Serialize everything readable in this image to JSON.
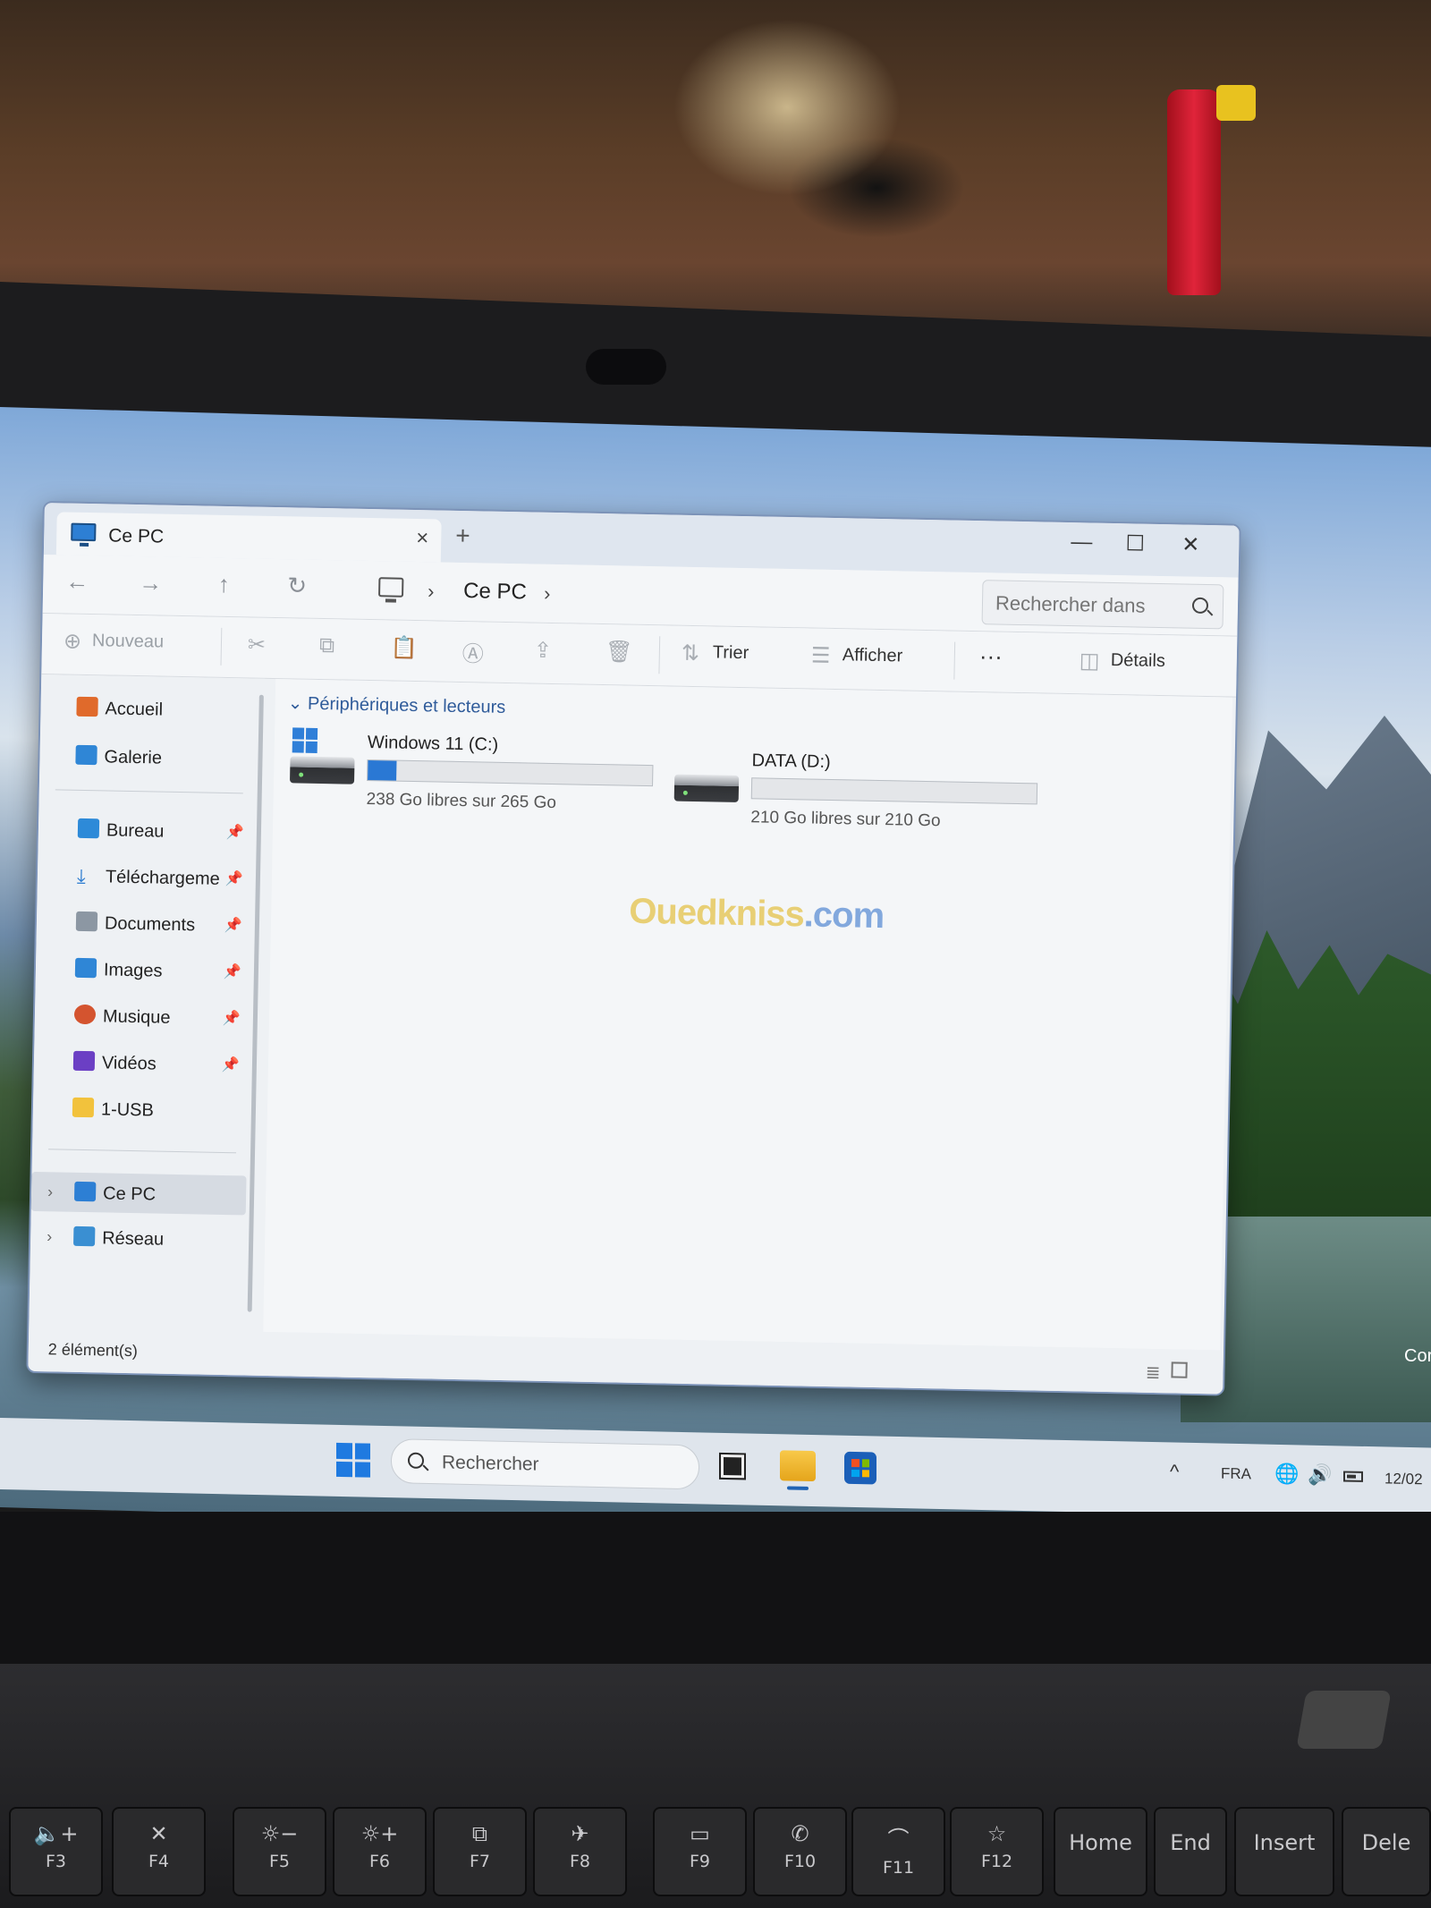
{
  "window": {
    "tab_title": "Ce PC",
    "tab_close": "×",
    "new_tab": "+",
    "minimize": "—",
    "maximize": "☐",
    "close": "✕"
  },
  "nav": {
    "back": "←",
    "forward": "→",
    "up": "↑",
    "refresh": "↻",
    "sep": "›",
    "breadcrumb": "Ce PC",
    "search_placeholder": "Rechercher dans"
  },
  "commands": {
    "new": "Nouveau",
    "sort": "Trier",
    "view": "Afficher",
    "more": "···",
    "details": "Détails"
  },
  "sidebar": {
    "items": [
      {
        "label": "Accueil",
        "icon": "home-icon"
      },
      {
        "label": "Galerie",
        "icon": "gallery-icon"
      },
      {
        "label": "Bureau",
        "icon": "desktop-folder-icon"
      },
      {
        "label": "Téléchargeme",
        "icon": "download-icon"
      },
      {
        "label": "Documents",
        "icon": "documents-icon"
      },
      {
        "label": "Images",
        "icon": "pictures-icon"
      },
      {
        "label": "Musique",
        "icon": "music-icon"
      },
      {
        "label": "Vidéos",
        "icon": "videos-icon"
      },
      {
        "label": "1-USB",
        "icon": "folder-icon"
      },
      {
        "label": "Ce PC",
        "icon": "computer-icon"
      },
      {
        "label": "Réseau",
        "icon": "network-icon"
      }
    ],
    "pin": "📌",
    "chevron": "›"
  },
  "content": {
    "section_title": "Périphériques et lecteurs",
    "drives": [
      {
        "name": "Windows 11 (C:)",
        "free_text": "238 Go libres sur 265 Go",
        "used_fraction": 0.1
      },
      {
        "name": "DATA (D:)",
        "free_text": "210 Go libres sur 210 Go",
        "used_fraction": 0.0
      }
    ],
    "watermark_a": "Ouedkniss",
    "watermark_b": ".com"
  },
  "status": {
    "count": "2 élément(s)",
    "list_view": "≣"
  },
  "taskbar": {
    "search": "Rechercher",
    "chevron": "^",
    "language": "FRA",
    "network": "🌐",
    "volume": "🔊",
    "date": "12/02"
  },
  "desktop_label": "Cor",
  "keys": [
    {
      "icon": "🔈+",
      "label": "F3"
    },
    {
      "icon": "✕",
      "label": "F4"
    },
    {
      "icon": "☼−",
      "label": "F5"
    },
    {
      "icon": "☼+",
      "label": "F6"
    },
    {
      "icon": "⧉",
      "label": "F7"
    },
    {
      "icon": "✈",
      "label": "F8"
    },
    {
      "icon": "▭",
      "label": "F9"
    },
    {
      "icon": "✆",
      "label": "F10"
    },
    {
      "icon": "⌒",
      "label": "F11"
    },
    {
      "icon": "☆",
      "label": "F12"
    },
    {
      "word": "Home"
    },
    {
      "word": "End"
    },
    {
      "word": "Insert"
    },
    {
      "word": "Dele"
    }
  ]
}
